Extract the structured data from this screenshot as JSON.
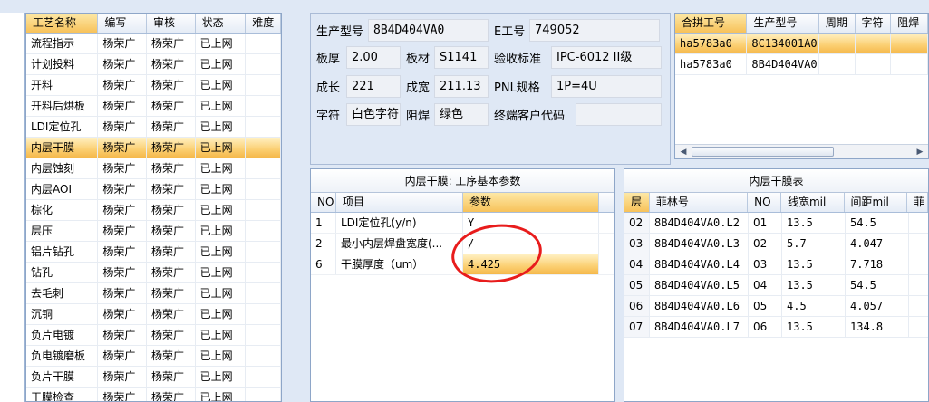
{
  "process_list": {
    "headers": [
      "工艺名称",
      "编写",
      "审核",
      "状态",
      "难度"
    ],
    "rows": [
      [
        "流程指示",
        "杨荣广",
        "杨荣广",
        "已上网",
        ""
      ],
      [
        "计划投料",
        "杨荣广",
        "杨荣广",
        "已上网",
        ""
      ],
      [
        "开料",
        "杨荣广",
        "杨荣广",
        "已上网",
        ""
      ],
      [
        "开料后烘板",
        "杨荣广",
        "杨荣广",
        "已上网",
        ""
      ],
      [
        "LDI定位孔",
        "杨荣广",
        "杨荣广",
        "已上网",
        ""
      ],
      [
        "内层干膜",
        "杨荣广",
        "杨荣广",
        "已上网",
        ""
      ],
      [
        "内层蚀刻",
        "杨荣广",
        "杨荣广",
        "已上网",
        ""
      ],
      [
        "内层AOI",
        "杨荣广",
        "杨荣广",
        "已上网",
        ""
      ],
      [
        "棕化",
        "杨荣广",
        "杨荣广",
        "已上网",
        ""
      ],
      [
        "层压",
        "杨荣广",
        "杨荣广",
        "已上网",
        ""
      ],
      [
        "铝片钻孔",
        "杨荣广",
        "杨荣广",
        "已上网",
        ""
      ],
      [
        "钻孔",
        "杨荣广",
        "杨荣广",
        "已上网",
        ""
      ],
      [
        "去毛刺",
        "杨荣广",
        "杨荣广",
        "已上网",
        ""
      ],
      [
        "沉铜",
        "杨荣广",
        "杨荣广",
        "已上网",
        ""
      ],
      [
        "负片电镀",
        "杨荣广",
        "杨荣广",
        "已上网",
        ""
      ],
      [
        "负电镀磨板",
        "杨荣广",
        "杨荣广",
        "已上网",
        ""
      ],
      [
        "负片干膜",
        "杨荣广",
        "杨荣广",
        "已上网",
        ""
      ],
      [
        "干膜检查",
        "杨荣广",
        "杨荣广",
        "已上网",
        ""
      ]
    ],
    "selected_index": 5
  },
  "info": {
    "product_model_label": "生产型号",
    "product_model": "8B4D404VA0",
    "e_no_label": "E工号",
    "e_no": "749052",
    "thickness_label": "板厚",
    "thickness": "2.00",
    "material_label": "板材",
    "material": "S1141",
    "standard_label": "验收标准",
    "standard": "IPC-6012 II级",
    "length_label": "成长",
    "length": "221",
    "width_label": "成宽",
    "width": "211.13",
    "pnl_label": "PNL规格",
    "pnl": "1P=4U",
    "char_label": "字符",
    "char": "白色字符",
    "mask_label": "阻焊",
    "mask": "绿色",
    "customer_label": "终端客户代码",
    "customer": ""
  },
  "joint": {
    "headers": [
      "合拼工号",
      "生产型号",
      "周期",
      "字符",
      "阻焊"
    ],
    "rows": [
      [
        "ha5783a0",
        "8C134001A0",
        "",
        "",
        ""
      ],
      [
        "ha5783a0",
        "8B4D404VA0",
        "",
        "",
        ""
      ]
    ]
  },
  "params": {
    "title": "内层干膜: 工序基本参数",
    "headers": [
      "NO",
      "项目",
      "参数"
    ],
    "rows": [
      [
        "1",
        "LDI定位孔(y/n)",
        "Y"
      ],
      [
        "2",
        "最小内层焊盘宽度(...",
        "/"
      ],
      [
        "6",
        "干膜厚度（um）",
        "4.425"
      ]
    ]
  },
  "layers": {
    "title": "内层干膜表",
    "headers": [
      "层",
      "菲林号",
      "NO",
      "线宽mil",
      "间距mil",
      "菲"
    ],
    "rows": [
      [
        "02",
        "8B4D404VA0.L2",
        "01",
        "13.5",
        "54.5"
      ],
      [
        "03",
        "8B4D404VA0.L3",
        "02",
        "5.7",
        "4.047"
      ],
      [
        "04",
        "8B4D404VA0.L4",
        "03",
        "13.5",
        "7.718"
      ],
      [
        "05",
        "8B4D404VA0.L5",
        "04",
        "13.5",
        "54.5"
      ],
      [
        "06",
        "8B4D404VA0.L6",
        "05",
        "4.5",
        "4.057"
      ],
      [
        "07",
        "8B4D404VA0.L7",
        "06",
        "13.5",
        "134.8"
      ]
    ]
  }
}
